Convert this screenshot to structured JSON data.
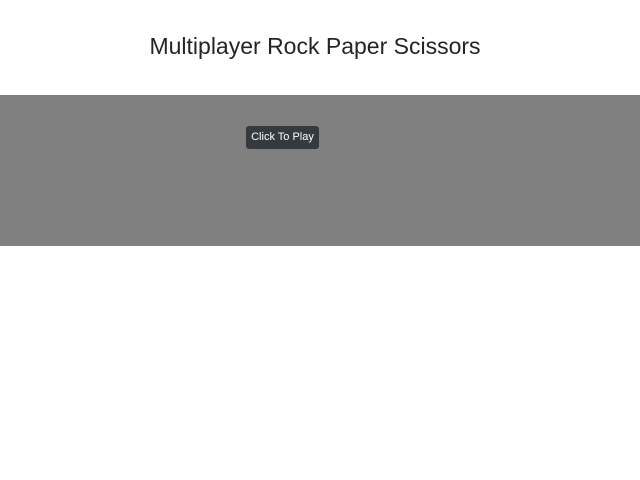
{
  "header": {
    "title": "Multiplayer Rock Paper Scissors"
  },
  "game_panel": {
    "play_button_label": "Click To Play",
    "background_color": "#808080",
    "button_color": "#343a40"
  }
}
